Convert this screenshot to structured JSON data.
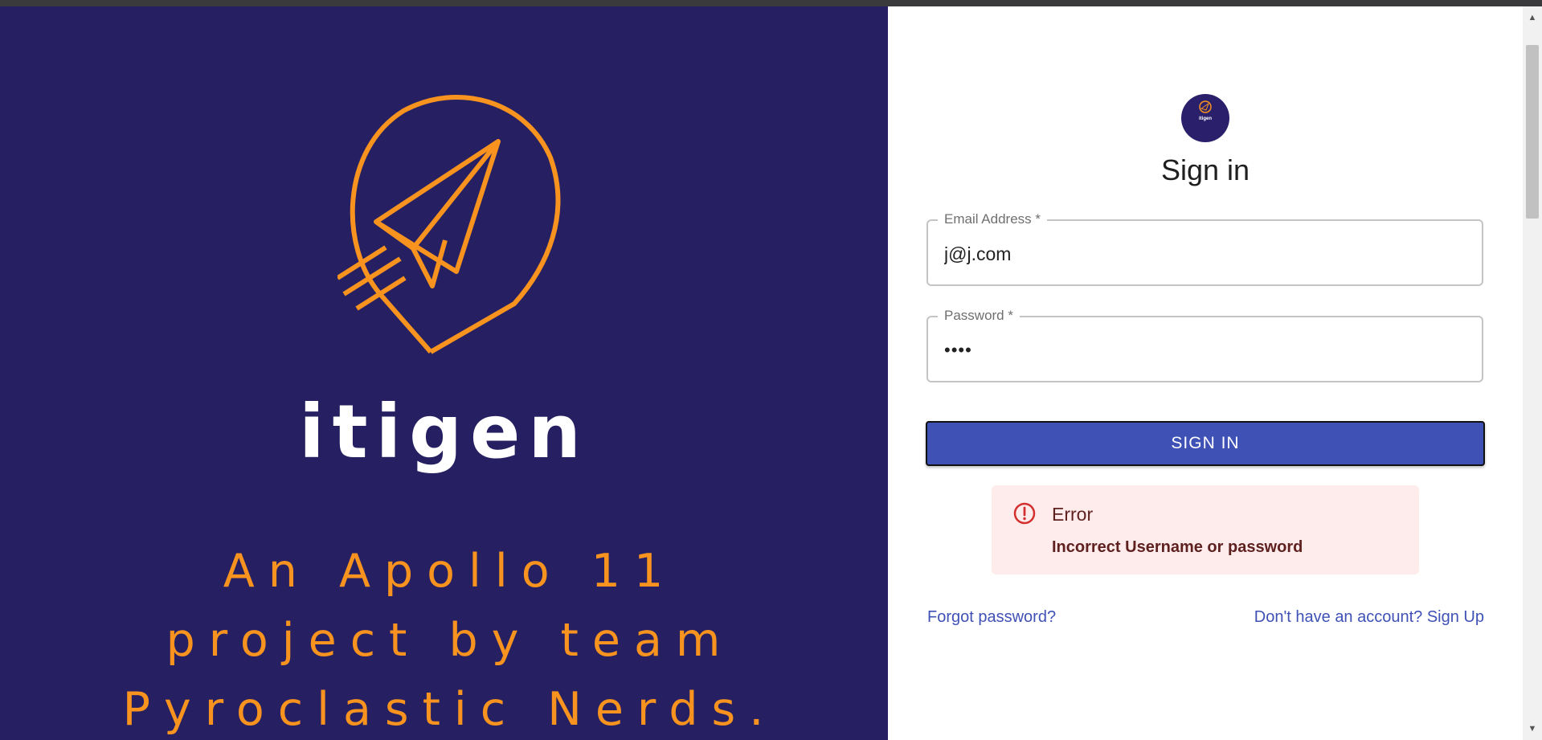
{
  "hero": {
    "brand": "itigen",
    "tagline": "An Apollo 11 project by team Pyroclastic Nerds.",
    "colors": {
      "background": "#262062",
      "accent": "#f7931e"
    },
    "logo_icon": "location-pin-paper-plane-icon"
  },
  "form": {
    "avatar_label": "itigen",
    "title": "Sign in",
    "email": {
      "label": "Email Address *",
      "value": "j@j.com"
    },
    "password": {
      "label": "Password *",
      "value": "••••"
    },
    "submit_label": "SIGN IN"
  },
  "alert": {
    "title": "Error",
    "message": "Incorrect Username or password",
    "icon": "error-outline-icon"
  },
  "links": {
    "forgot": "Forgot password?",
    "signup": "Don't have an account? Sign Up"
  },
  "colors": {
    "primary": "#3f51b5",
    "error_bg": "#fdeceb",
    "error_text": "#5f2120",
    "error_icon": "#d32f2f"
  }
}
